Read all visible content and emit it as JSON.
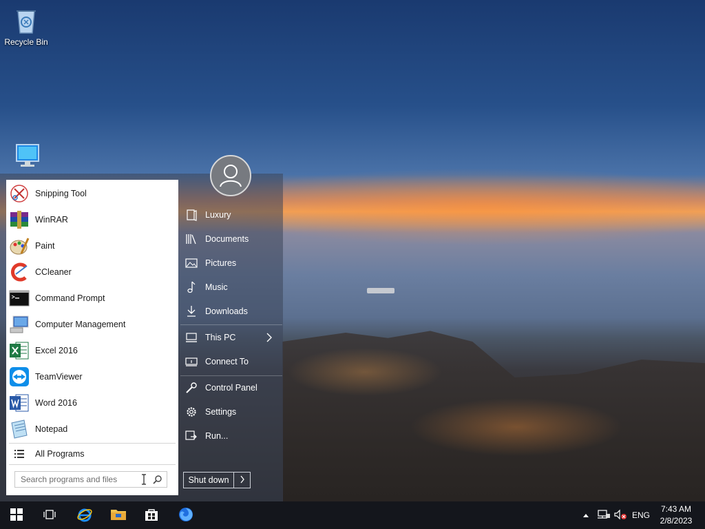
{
  "desktop": {
    "icons": [
      {
        "label": "Recycle Bin",
        "icon": "recycle-bin-icon"
      },
      {
        "label": "",
        "icon": "this-pc-icon"
      }
    ]
  },
  "start_menu": {
    "programs": [
      {
        "label": "Snipping Tool",
        "icon": "snipping-tool-icon"
      },
      {
        "label": "WinRAR",
        "icon": "winrar-icon"
      },
      {
        "label": "Paint",
        "icon": "paint-icon"
      },
      {
        "label": "CCleaner",
        "icon": "ccleaner-icon"
      },
      {
        "label": "Command Prompt",
        "icon": "command-prompt-icon"
      },
      {
        "label": "Computer Management",
        "icon": "computer-management-icon"
      },
      {
        "label": "Excel 2016",
        "icon": "excel-icon"
      },
      {
        "label": "TeamViewer",
        "icon": "teamviewer-icon"
      },
      {
        "label": "Word 2016",
        "icon": "word-icon"
      },
      {
        "label": "Notepad",
        "icon": "notepad-icon"
      }
    ],
    "all_programs": "All Programs",
    "search_placeholder": "Search programs and files",
    "places": [
      {
        "label": "Luxury",
        "icon": "user-folder-icon"
      },
      {
        "label": "Documents",
        "icon": "documents-icon"
      },
      {
        "label": "Pictures",
        "icon": "pictures-icon"
      },
      {
        "label": "Music",
        "icon": "music-icon"
      },
      {
        "label": "Downloads",
        "icon": "downloads-icon"
      },
      {
        "label": "This PC",
        "icon": "computer-icon"
      },
      {
        "label": "Connect To",
        "icon": "connect-to-icon"
      },
      {
        "label": "Control Panel",
        "icon": "control-panel-icon"
      },
      {
        "label": "Settings",
        "icon": "settings-icon"
      },
      {
        "label": "Run...",
        "icon": "run-icon"
      }
    ],
    "shutdown_label": "Shut down"
  },
  "taskbar": {
    "buttons": [
      "start-button",
      "task-view-button",
      "internet-explorer-button",
      "file-explorer-button",
      "store-button",
      "firefox-button"
    ],
    "language": "ENG",
    "time": "7:43 AM",
    "date": "2/8/2023"
  },
  "colors": {
    "taskbar": "#14161c",
    "start_panel": "#ffffff"
  }
}
